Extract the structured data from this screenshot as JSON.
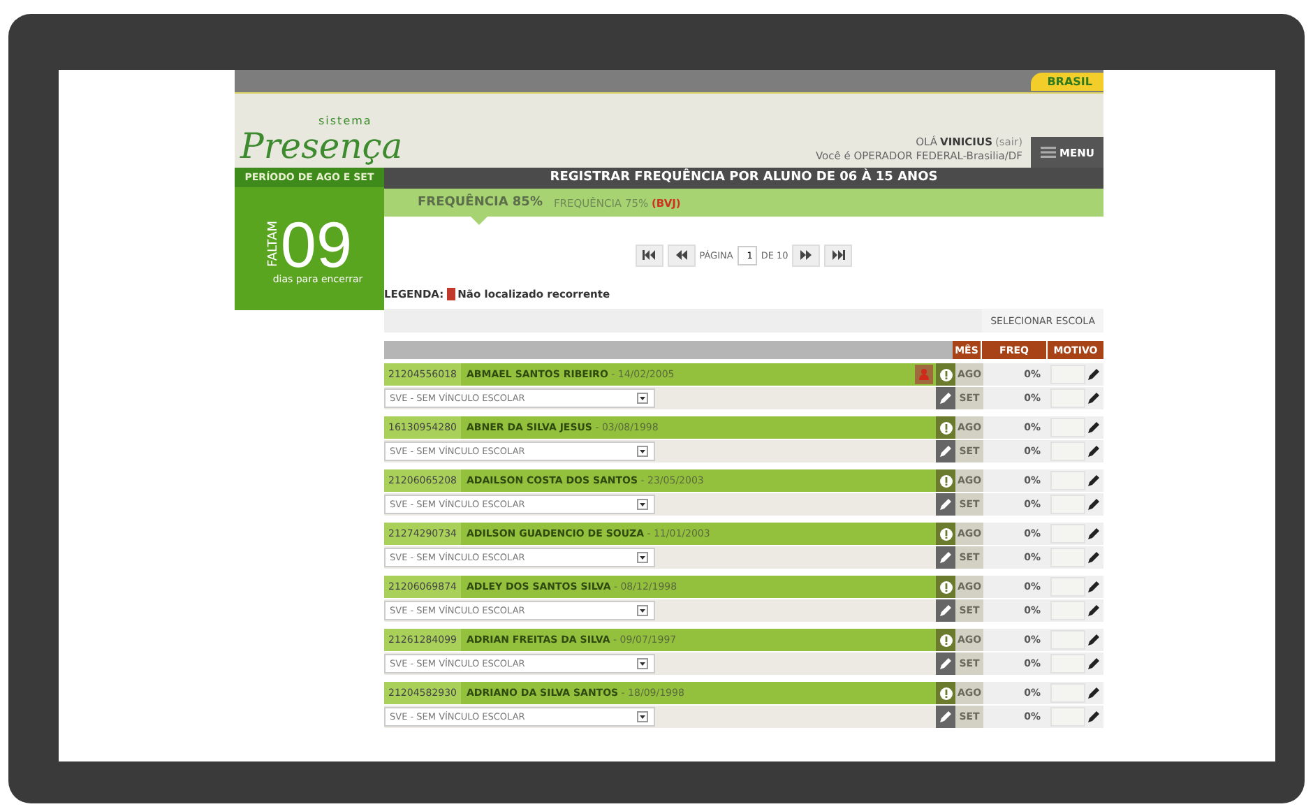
{
  "top_bar": {
    "brand": "BRASIL"
  },
  "header": {
    "logo_small": "sistema",
    "logo": "Presença",
    "greeting": "OLÁ",
    "user": "VINICIUS",
    "logout": "(sair)",
    "role": "Você é OPERADOR FEDERAL-Brasilia/DF",
    "menu": "MENU"
  },
  "sidebar": {
    "period": "PERÍODO DE AGO E SET",
    "faltam": "FALTAM",
    "count": "09",
    "caption": "dias para encerrar"
  },
  "title": "REGISTRAR FREQUÊNCIA POR ALUNO DE 06 À 15 ANOS",
  "tabs": [
    {
      "label": "FREQUÊNCIA 85%",
      "selected": true
    },
    {
      "label": "FREQUÊNCIA 75%",
      "suffix": "(BVJ)",
      "selected": false
    }
  ],
  "pager": {
    "label": "PÁGINA",
    "page": "1",
    "total": "DE 10"
  },
  "legend": {
    "label": "LEGENDA:",
    "text": "Não localizado recorrente",
    "color": "#c0392b"
  },
  "school_button": "SELECIONAR ESCOLA",
  "columns": [
    "MÊS",
    "FREQ",
    "MOTIVO"
  ],
  "students": [
    {
      "id": "21204556018",
      "name": "ABMAEL SANTOS RIBEIRO",
      "birth": "- 14/02/2005",
      "alert": true,
      "school": "SVE - SEM VÍNCULO ESCOLAR",
      "months": [
        {
          "month": "AGO",
          "freq": "0%"
        },
        {
          "month": "SET",
          "freq": "0%"
        }
      ]
    },
    {
      "id": "16130954280",
      "name": "ABNER DA SILVA JESUS",
      "birth": "- 03/08/1998",
      "alert": false,
      "school": "SVE - SEM VÍNCULO ESCOLAR",
      "months": [
        {
          "month": "AGO",
          "freq": "0%"
        },
        {
          "month": "SET",
          "freq": "0%"
        }
      ]
    },
    {
      "id": "21206065208",
      "name": "ADAILSON COSTA DOS SANTOS",
      "birth": "- 23/05/2003",
      "alert": false,
      "school": "SVE - SEM VÍNCULO ESCOLAR",
      "months": [
        {
          "month": "AGO",
          "freq": "0%"
        },
        {
          "month": "SET",
          "freq": "0%"
        }
      ]
    },
    {
      "id": "21274290734",
      "name": "ADILSON GUADENCIO DE SOUZA",
      "birth": "- 11/01/2003",
      "alert": false,
      "school": "SVE - SEM VÍNCULO ESCOLAR",
      "months": [
        {
          "month": "AGO",
          "freq": "0%"
        },
        {
          "month": "SET",
          "freq": "0%"
        }
      ]
    },
    {
      "id": "21206069874",
      "name": "ADLEY DOS SANTOS SILVA",
      "birth": "- 08/12/1998",
      "alert": false,
      "school": "SVE - SEM VÍNCULO ESCOLAR",
      "months": [
        {
          "month": "AGO",
          "freq": "0%"
        },
        {
          "month": "SET",
          "freq": "0%"
        }
      ]
    },
    {
      "id": "21261284099",
      "name": "ADRIAN FREITAS DA SILVA",
      "birth": "- 09/07/1997",
      "alert": false,
      "school": "SVE - SEM VÍNCULO ESCOLAR",
      "months": [
        {
          "month": "AGO",
          "freq": "0%"
        },
        {
          "month": "SET",
          "freq": "0%"
        }
      ]
    },
    {
      "id": "21204582930",
      "name": "ADRIANO DA SILVA SANTOS",
      "birth": "- 18/09/1998",
      "alert": false,
      "school": "SVE - SEM VÍNCULO ESCOLAR",
      "months": [
        {
          "month": "AGO",
          "freq": "0%"
        },
        {
          "month": "SET",
          "freq": "0%"
        }
      ]
    }
  ]
}
